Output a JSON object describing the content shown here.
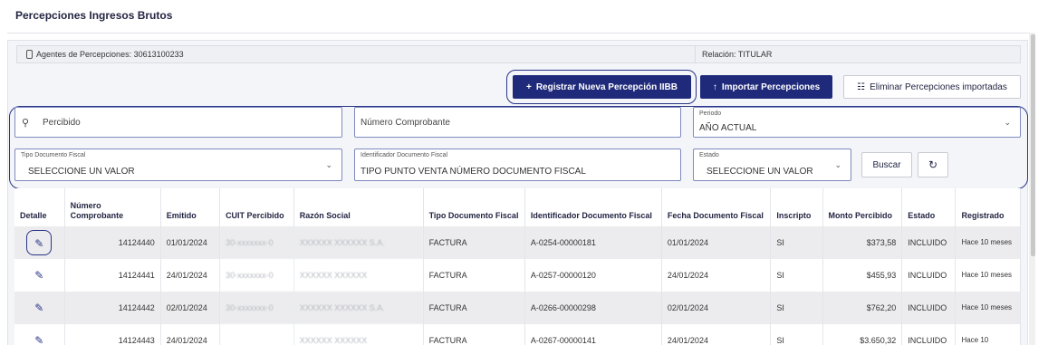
{
  "page": {
    "title": "Percepciones Ingresos Brutos"
  },
  "info": {
    "agent_label": "Agentes de Percepciones: 30613100233",
    "relation_label": "Relación: TITULAR"
  },
  "actions": {
    "register": "Registrar Nueva Percepción IIBB",
    "import": "Importar Percepciones",
    "delete": "Eliminar Percepciones importadas"
  },
  "filters": {
    "percibido_placeholder": "Percibido",
    "comprobante_placeholder": "Número Comprobante",
    "periodo_label": "Periodo",
    "periodo_value": "AÑO ACTUAL",
    "tipodoc_label": "Tipo Documento Fiscal",
    "tipodoc_value": "SELECCIONE UN VALOR",
    "ident_label": "Identificador Documento Fiscal",
    "ident_value": "TIPO PUNTO VENTA NÚMERO DOCUMENTO FISCAL",
    "estado_label": "Estado",
    "estado_value": "SELECCIONE UN VALOR",
    "search_button": "Buscar"
  },
  "table": {
    "headers": {
      "detalle": "Detalle",
      "numero": "Número Comprobante",
      "emitido": "Emitido",
      "cuit": "CUIT Percibido",
      "razon": "Razón Social",
      "tipo": "Tipo Documento Fiscal",
      "ident": "Identificador Documento Fiscal",
      "fecha": "Fecha Documento Fiscal",
      "inscripto": "Inscripto",
      "monto": "Monto Percibido",
      "estado": "Estado",
      "registrado": "Registrado"
    },
    "rows": [
      {
        "numero": "14124440",
        "emitido": "01/01/2024",
        "cuit": "30-xxxxxxx-0",
        "razon": "XXXXXX XXXXXX S.A.",
        "tipo": "FACTURA",
        "ident": "A-0254-00000181",
        "fecha": "01/01/2024",
        "inscripto": "SI",
        "monto": "$373,58",
        "estado": "INCLUIDO",
        "registrado": "Hace 10 meses"
      },
      {
        "numero": "14124441",
        "emitido": "24/01/2024",
        "cuit": "30-xxxxxxx-0",
        "razon": "XXXXXX XXXXXX",
        "tipo": "FACTURA",
        "ident": "A-0257-00000120",
        "fecha": "24/01/2024",
        "inscripto": "SI",
        "monto": "$455,93",
        "estado": "INCLUIDO",
        "registrado": "Hace 10 meses"
      },
      {
        "numero": "14124442",
        "emitido": "02/01/2024",
        "cuit": "30-xxxxxxx-0",
        "razon": "XXXXXX XXXXXX S.A.",
        "tipo": "FACTURA",
        "ident": "A-0266-00000298",
        "fecha": "02/01/2024",
        "inscripto": "SI",
        "monto": "$762,20",
        "estado": "INCLUIDO",
        "registrado": "Hace 10 meses"
      },
      {
        "numero": "14124443",
        "emitido": "24/01/2024",
        "cuit": "",
        "razon": "XXXXXX XXXXXX",
        "tipo": "FACTURA",
        "ident": "A-0267-00000141",
        "fecha": "24/01/2024",
        "inscripto": "SI",
        "monto": "$3.650,32",
        "estado": "INCLUIDO",
        "registrado": "Hace 10"
      }
    ]
  }
}
